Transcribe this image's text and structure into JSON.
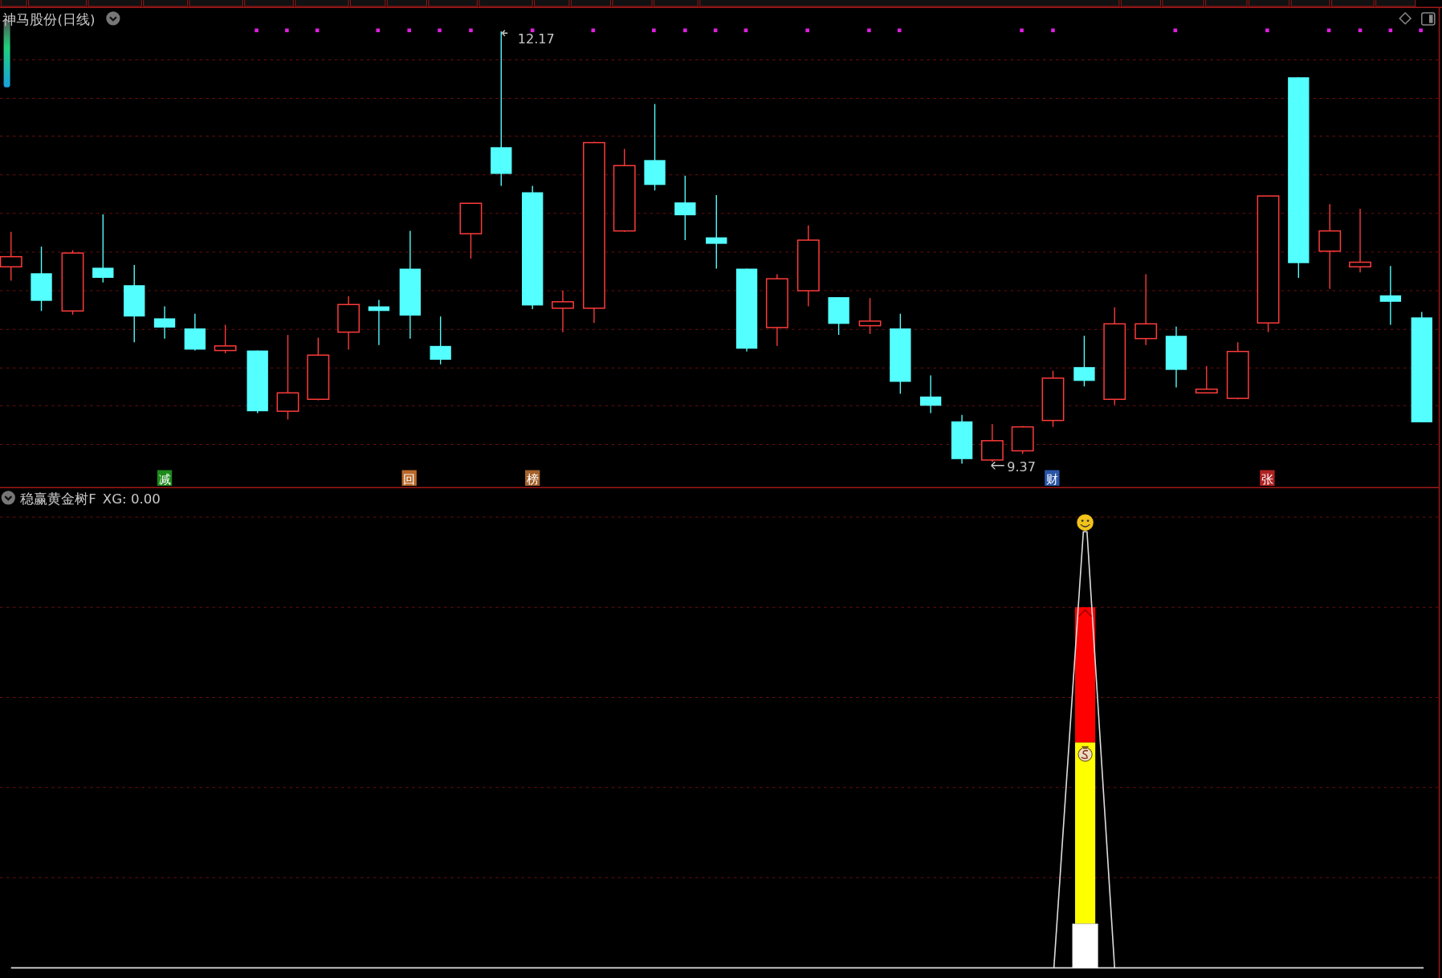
{
  "main_pane": {
    "title": "神马股份(日线)",
    "high_label": "12.17",
    "low_label": "9.37",
    "markers": [
      {
        "text": "减",
        "color": "#1c8a1c"
      },
      {
        "text": "回",
        "color": "#b8692a"
      },
      {
        "text": "榜",
        "color": "#a4622c"
      },
      {
        "text": "财",
        "color": "#2a56a8"
      },
      {
        "text": "张",
        "color": "#b02222"
      }
    ]
  },
  "indicator_pane": {
    "name": "稳赢黄金树F",
    "reading": "XG: 0.00"
  }
}
